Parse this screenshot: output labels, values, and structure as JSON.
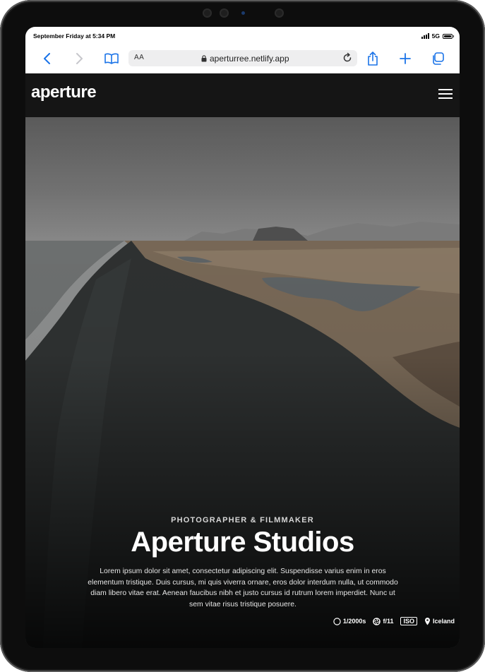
{
  "status_bar": {
    "time": "September Friday at 5:34 PM",
    "network": "5G"
  },
  "browser": {
    "text_size_label": "AA",
    "url": "aperturree.netlify.app",
    "icons": [
      "back-icon",
      "forward-icon",
      "bookmarks-icon",
      "lock-icon",
      "reload-icon",
      "share-icon",
      "new-tab-icon",
      "tabs-icon"
    ]
  },
  "site": {
    "logo": "aperture",
    "menu_icon": "hamburger-menu-icon"
  },
  "hero": {
    "kicker": "PHOTOGRAPHER & FILMMAKER",
    "title": "Aperture Studios",
    "description": "Lorem ipsum dolor sit amet, consectetur adipiscing elit. Suspendisse varius enim in eros elementum tristique. Duis cursus, mi quis viverra ornare, eros dolor interdum nulla, ut commodo diam libero vitae erat. Aenean faucibus nibh et justo cursus id rutrum lorem imperdiet. Nunc ut sem vitae risus tristique posuere.",
    "meta": {
      "shutter": "1/2000s",
      "aperture": "f/11",
      "iso_label": "ISO",
      "location": "Iceland"
    }
  },
  "colors": {
    "accent": "#1a73e8",
    "header_bg": "#151515"
  }
}
